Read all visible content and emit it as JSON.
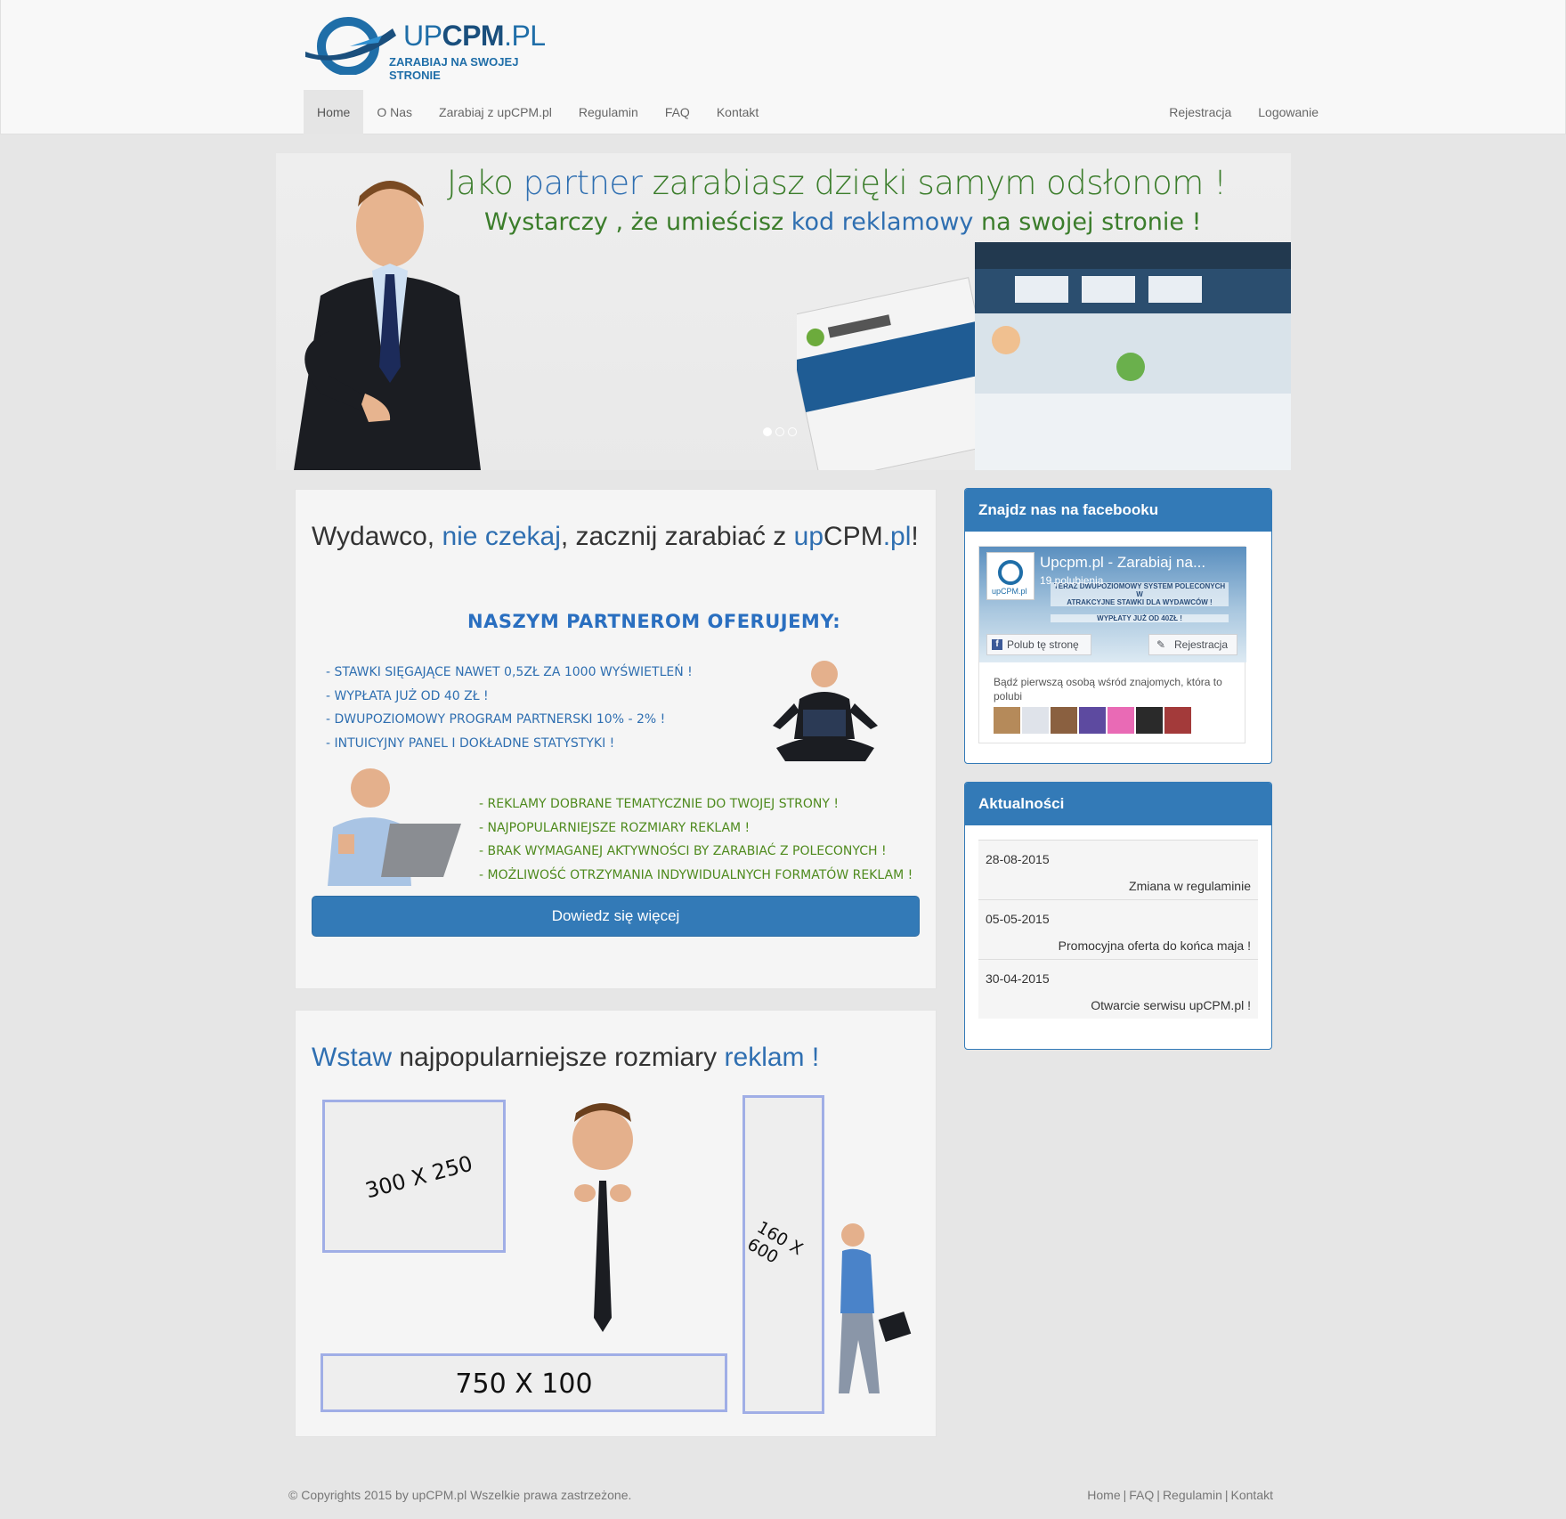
{
  "brand": {
    "name_light": "UP",
    "name_bold": "CPM",
    "name_tld": ".PL",
    "tagline": "ZARABIAJ NA SWOJEJ STRONIE"
  },
  "nav": {
    "left": [
      "Home",
      "O Nas",
      "Zarabiaj z upCPM.pl",
      "Regulamin",
      "FAQ",
      "Kontakt"
    ],
    "right": [
      "Rejestracja",
      "Logowanie"
    ],
    "active": "Home"
  },
  "banner": {
    "line1": [
      "Jako ",
      "partner",
      " zarabiasz dzięki samym odsłonom !"
    ],
    "line2": [
      "Wystarczy , że umieścisz ",
      "kod reklamowy",
      " na swojej stronie !"
    ],
    "slides": 3,
    "active_slide": 1
  },
  "publisher": {
    "title": [
      "Wydawco, ",
      "nie czekaj",
      ", zacznij zarabiać z ",
      "up",
      "CPM",
      ".pl",
      "!"
    ],
    "offer_title": "NASZYM PARTNEROM OFERUJEMY:",
    "list_a": [
      "- STAWKI SIĘGAJĄCE NAWET 0,5ZŁ ZA 1000 WYŚWIETLEŃ !",
      "- WYPŁATA JUŻ OD 40 ZŁ !",
      "- DWUPOZIOMOWY PROGRAM PARTNERSKI 10% - 2% !",
      "- INTUICYJNY PANEL I DOKŁADNE STATYSTYKI !"
    ],
    "list_b": [
      "- REKLAMY DOBRANE TEMATYCZNIE DO TWOJEJ STRONY !",
      "- NAJPOPULARNIEJSZE ROZMIARY REKLAM !",
      "- BRAK WYMAGANEJ AKTYWNOŚCI BY ZARABIAĆ Z POLECONYCH !",
      "- MOŻLIWOŚĆ OTRZYMANIA INDYWIDUALNYCH FORMATÓW REKLAM !"
    ],
    "button": "Dowiedz się więcej"
  },
  "formats": {
    "title": [
      "Wstaw",
      " najpopularniejsze rozmiary ",
      "reklam !"
    ],
    "ad_300": "300 X 250",
    "ad_160": "160 X 600",
    "ad_750": "750 X 100"
  },
  "facebook": {
    "heading": "Znajdz nas na facebooku",
    "page_name": "Upcpm.pl - Zarabiaj na...",
    "likes": "19 polubienia",
    "cover_lines": [
      "TERAZ DWUPOZIOMOWY SYSTEM POLECONYCH W",
      "ATRAKCYJNE STAWKI DLA WYDAWCÓW !",
      "WYPŁATY JUŻ OD 40ZŁ !"
    ],
    "like_button": "Polub tę stronę",
    "register_button": "Rejestracja",
    "friends_text": "Bądź pierwszą osobą wśród znajomych, która to polubi"
  },
  "news": {
    "heading": "Aktualności",
    "items": [
      {
        "date": "28-08-2015",
        "title": "Zmiana w regulaminie"
      },
      {
        "date": "05-05-2015",
        "title": "Promocyjna oferta do końca maja !"
      },
      {
        "date": "30-04-2015",
        "title": "Otwarcie serwisu upCPM.pl !"
      }
    ]
  },
  "footer": {
    "copyright": "© Copyrights 2015 by upCPM.pl Wszelkie prawa zastrzeżone.",
    "links": [
      "Home",
      "FAQ",
      "Regulamin",
      "Kontakt"
    ]
  },
  "colors": {
    "primary": "#337ab7",
    "banner_green": "#3b7d2b",
    "offer_blue": "#2f6fb1",
    "offer_green": "#4e8a1d"
  }
}
